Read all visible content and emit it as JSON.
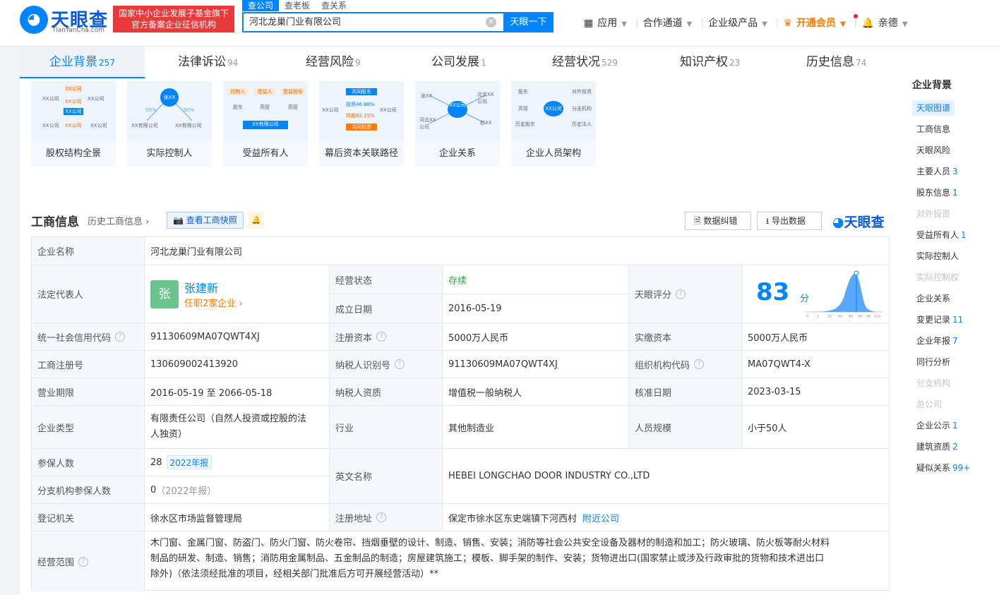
{
  "brand": {
    "name": "天眼查",
    "sub": "TianYanCha.com",
    "badge_line1": "国家中小企业发展子基金旗下",
    "badge_line2": "官方备案企业征信机构"
  },
  "search": {
    "tabs": [
      "查公司",
      "查老板",
      "查关系"
    ],
    "value": "河北龙巢门业有限公司",
    "button": "天眼一下"
  },
  "topnav": {
    "app": "应用",
    "coop": "合作通道",
    "enterprise": "企业级产品",
    "vip": "开通会员",
    "user": "亲德"
  },
  "tabs": [
    {
      "label": "企业背景",
      "count": "257"
    },
    {
      "label": "法律诉讼",
      "count": "94"
    },
    {
      "label": "经营风险",
      "count": "9"
    },
    {
      "label": "公司发展",
      "count": "1"
    },
    {
      "label": "经营状况",
      "count": "529"
    },
    {
      "label": "知识产权",
      "count": "23"
    },
    {
      "label": "历史信息",
      "count": "74"
    }
  ],
  "cards": [
    "股权结构全景",
    "实际控制人",
    "受益所有人",
    "幕后资本关联路径",
    "企业关系",
    "企业人员架构"
  ],
  "card_art": {
    "c1": {
      "a": "XX公司",
      "b": "XX公司",
      "c": "XX公司",
      "d": "XX公司",
      "e": "XX公司",
      "f": "XX公司",
      "g": "XX公司",
      "h": "XX公司"
    },
    "c2": {
      "center": "张XX",
      "left": "XX有限公司",
      "right": "XX有限公司",
      "pl": "50%",
      "pr": "50%"
    },
    "c3": {
      "t1": "控制人",
      "t2": "受益人",
      "t3": "受益股份",
      "b1": "股东",
      "b2": "高管",
      "b3": "高管",
      "center": "XX有限公司"
    },
    "c4": {
      "top": "共同股东",
      "mid1": "投资46.88%",
      "mid2": "持股82.15%",
      "bot": "共同投资",
      "l": "XX公司",
      "r": "XX公司"
    },
    "c5": {
      "a": "张XX",
      "b": "XX公司",
      "c": "北京XX公司",
      "d": "河北XX公司",
      "e": "赵XX"
    },
    "c6": {
      "l1": "股东",
      "l2": "高管",
      "l3": "历史股东",
      "center": "XX公司",
      "r1": "对外投资",
      "r2": "分支机构",
      "r3": "历史法人"
    }
  },
  "section": {
    "title": "工商信息",
    "history": "历史工商信息",
    "snapshot": "查看工商快照",
    "correct": "数据纠错",
    "export": "导出数据",
    "brand": "天眼查"
  },
  "info": {
    "company_name_label": "企业名称",
    "company_name": "河北龙巢门业有限公司",
    "legal_rep_label": "法定代表人",
    "legal_rep_avatar": "张",
    "legal_rep": "张建新",
    "legal_rep_sub": "任职2家企业",
    "status_label": "经营状态",
    "status": "存续",
    "founded_label": "成立日期",
    "founded": "2016-05-19",
    "score_label": "天眼评分",
    "score": "83",
    "score_unit": "分",
    "credit_code_label": "统一社会信用代码",
    "credit_code": "91130609MA07QWT4XJ",
    "reg_capital_label": "注册资本",
    "reg_capital": "5000万人民币",
    "paid_capital_label": "实缴资本",
    "paid_capital": "5000万人民币",
    "reg_no_label": "工商注册号",
    "reg_no": "130609002413920",
    "tax_id_label": "纳税人识别号",
    "tax_id": "91130609MA07QWT4XJ",
    "org_code_label": "组织机构代码",
    "org_code": "MA07QWT4-X",
    "term_label": "营业期限",
    "term": "2016-05-19 至 2066-05-18",
    "tax_qual_label": "纳税人资质",
    "tax_qual": "增值税一般纳税人",
    "approve_label": "核准日期",
    "approve": "2023-03-15",
    "type_label": "企业类型",
    "type_line1": "有限责任公司（自然人投资或控股的法",
    "type_line2": "人独资）",
    "industry_label": "行业",
    "industry": "其他制造业",
    "staff_label": "人员规模",
    "staff": "小于50人",
    "insured_label": "参保人数",
    "insured": "28",
    "insured_tag": "2022年报",
    "english_label": "英文名称",
    "english": "HEBEI LONGCHAO DOOR INDUSTRY CO.,LTD",
    "branch_insured_label": "分支机构参保人数",
    "branch_insured": "0",
    "branch_insured_tag": "（2022年报）",
    "authority_label": "登记机关",
    "authority": "徐水区市场监督管理局",
    "address_label": "注册地址",
    "address": "保定市徐水区东史端镇下河西村",
    "nearby": "附近公司",
    "scope_label": "经营范围",
    "scope_line1": "木门窗、金属门窗、防盗门、防火门窗、防火卷帘、挡烟垂壁的设计、制造、销售、安装；消防等社会公共安全设备及器材的制造和加工；防火玻璃、防火板等耐火材料",
    "scope_line2": "制品的研发、制造、销售；消防用金属制品、五金制品的制造；房屋建筑施工；模板、脚手架的制作、安装；货物进出口(国家禁止或涉及行政审批的货物和技术进出口",
    "scope_line3": "除外)（依法须经批准的项目，经相关部门批准后方可开展经营活动）**"
  },
  "score_chart": {
    "ticks": [
      "0",
      "1",
      "15",
      "50",
      "65",
      "90",
      "99",
      "100"
    ]
  },
  "sidenav": {
    "title": "企业背景",
    "items": [
      {
        "label": "天眼图谱",
        "count": "",
        "state": "active"
      },
      {
        "label": "工商信息",
        "count": "",
        "state": ""
      },
      {
        "label": "天眼风险",
        "count": "",
        "state": ""
      },
      {
        "label": "主要人员",
        "count": "3",
        "state": ""
      },
      {
        "label": "股东信息",
        "count": "1",
        "state": ""
      },
      {
        "label": "对外投资",
        "count": "",
        "state": "dis"
      },
      {
        "label": "受益所有人",
        "count": "1",
        "state": ""
      },
      {
        "label": "实际控制人",
        "count": "",
        "state": ""
      },
      {
        "label": "实际控制权",
        "count": "",
        "state": "dis"
      },
      {
        "label": "企业关系",
        "count": "",
        "state": ""
      },
      {
        "label": "变更记录",
        "count": "11",
        "state": ""
      },
      {
        "label": "企业年报",
        "count": "7",
        "state": ""
      },
      {
        "label": "同行分析",
        "count": "",
        "state": ""
      },
      {
        "label": "分支机构",
        "count": "",
        "state": "dis"
      },
      {
        "label": "总公司",
        "count": "",
        "state": "dis"
      },
      {
        "label": "企业公示",
        "count": "1",
        "state": ""
      },
      {
        "label": "建筑资质",
        "count": "2",
        "state": ""
      },
      {
        "label": "疑似关系",
        "count": "99+",
        "state": ""
      }
    ]
  },
  "icons": [
    "logo-eye-icon",
    "clear-icon",
    "grid-icon",
    "chevron-down-icon",
    "crown-icon",
    "bell-icon",
    "camera-icon",
    "alert-icon",
    "document-icon",
    "download-icon",
    "question-icon",
    "chevron-right-icon"
  ],
  "colors": {
    "accent": "#0084ff",
    "badge_red": "#e83a3a",
    "status_green": "#22ab38",
    "vip_orange": "#ff7a00"
  }
}
